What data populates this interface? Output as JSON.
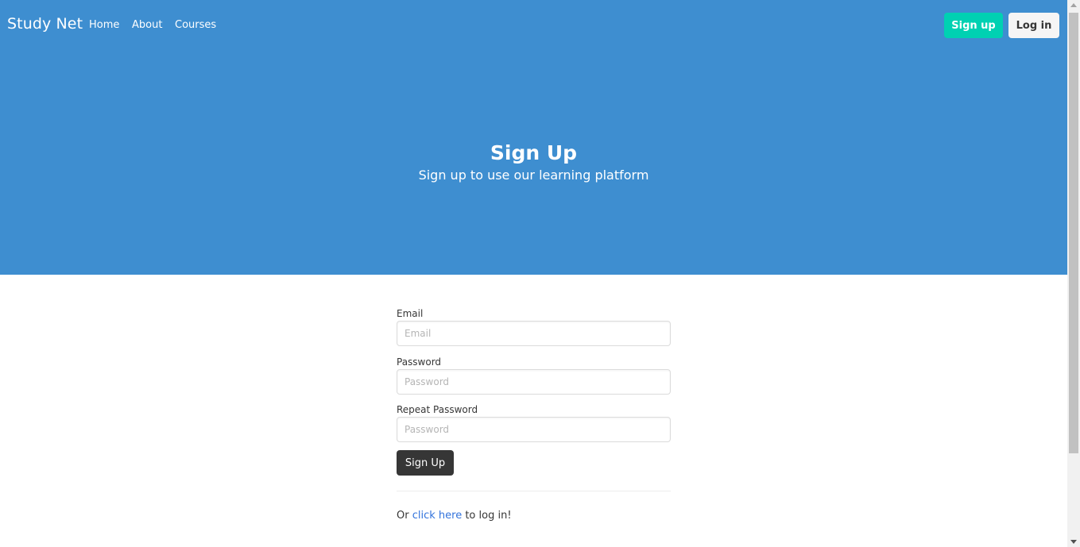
{
  "navbar": {
    "brand": "Study Net",
    "links": [
      "Home",
      "About",
      "Courses"
    ],
    "signup_label": "Sign up",
    "login_label": "Log in"
  },
  "hero": {
    "title": "Sign Up",
    "subtitle": "Sign up to use our learning platform"
  },
  "form": {
    "email_label": "Email",
    "email_placeholder": "Email",
    "password_label": "Password",
    "password_placeholder": "Password",
    "repeat_label": "Repeat Password",
    "repeat_placeholder": "Password",
    "submit_label": "Sign Up",
    "login_prefix": "Or ",
    "login_link": "click here",
    "login_suffix": " to log in!"
  },
  "colors": {
    "hero_bg": "#3e8ed0",
    "primary": "#00d1b2",
    "dark": "#363636",
    "link": "#3273dc"
  }
}
